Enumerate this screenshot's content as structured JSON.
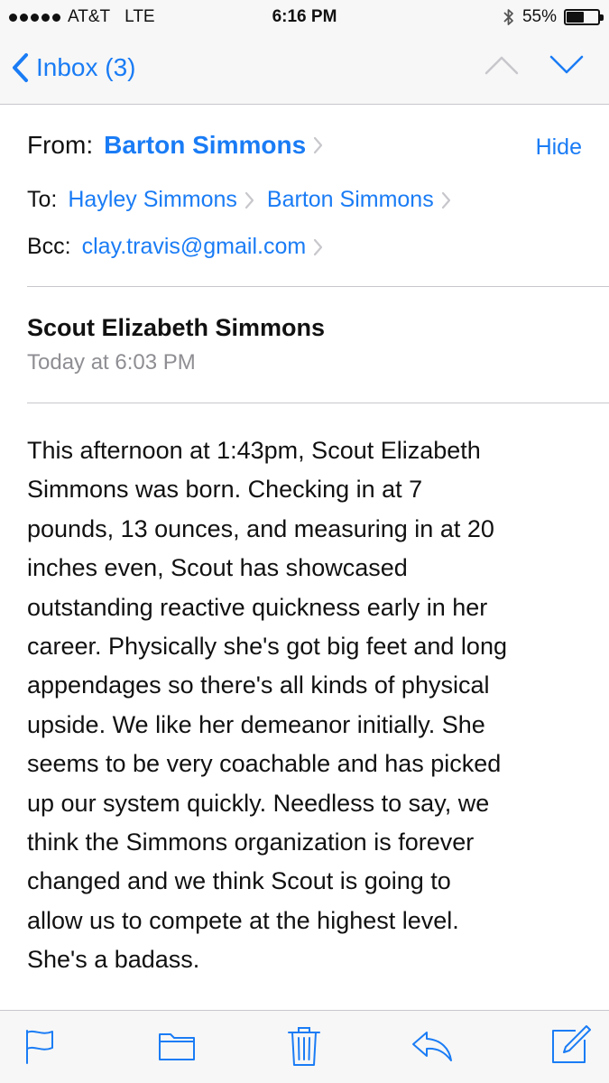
{
  "status_bar": {
    "carrier": "AT&T",
    "network": "LTE",
    "time": "6:16 PM",
    "battery_percent_label": "55%",
    "battery_level": 0.55,
    "bluetooth_icon": "bluetooth-icon",
    "signal_dots": 5
  },
  "nav": {
    "back_label": "Inbox (3)",
    "back_icon": "chevron-left-icon",
    "prev_icon": "chevron-up-icon",
    "next_icon": "chevron-down-icon"
  },
  "header": {
    "from_label": "From:",
    "from_name": "Barton Simmons",
    "hide_label": "Hide",
    "to_label": "To:",
    "to_recipients": [
      "Hayley Simmons",
      "Barton Simmons"
    ],
    "bcc_label": "Bcc:",
    "bcc_recipient": "clay.travis@gmail.com"
  },
  "message": {
    "subject": "Scout Elizabeth Simmons",
    "date": "Today at 6:03 PM",
    "body_lines": [
      "This afternoon at 1:43pm, Scout Elizabeth",
      "Simmons was born. Checking in at 7",
      "pounds, 13 ounces, and measuring in at 20",
      "inches even, Scout has showcased",
      "outstanding reactive quickness early in her",
      "career. Physically she's got big feet and long",
      "appendages so there's all kinds of physical",
      "upside. We like her demeanor initially. She",
      "seems to be very coachable and has picked",
      "up our system quickly. Needless to say, we",
      "think the Simmons organization is forever",
      "changed and we think Scout is going to",
      "allow us to compete at the highest level.",
      "She's a badass."
    ]
  },
  "toolbar": {
    "icons": [
      "flag-icon",
      "folder-icon",
      "trash-icon",
      "reply-icon",
      "compose-icon"
    ]
  },
  "colors": {
    "accent": "#1a7cf5",
    "secondary_text": "#8e8e93",
    "separator": "#c8c7cc",
    "bar_background": "#f7f7f7"
  }
}
